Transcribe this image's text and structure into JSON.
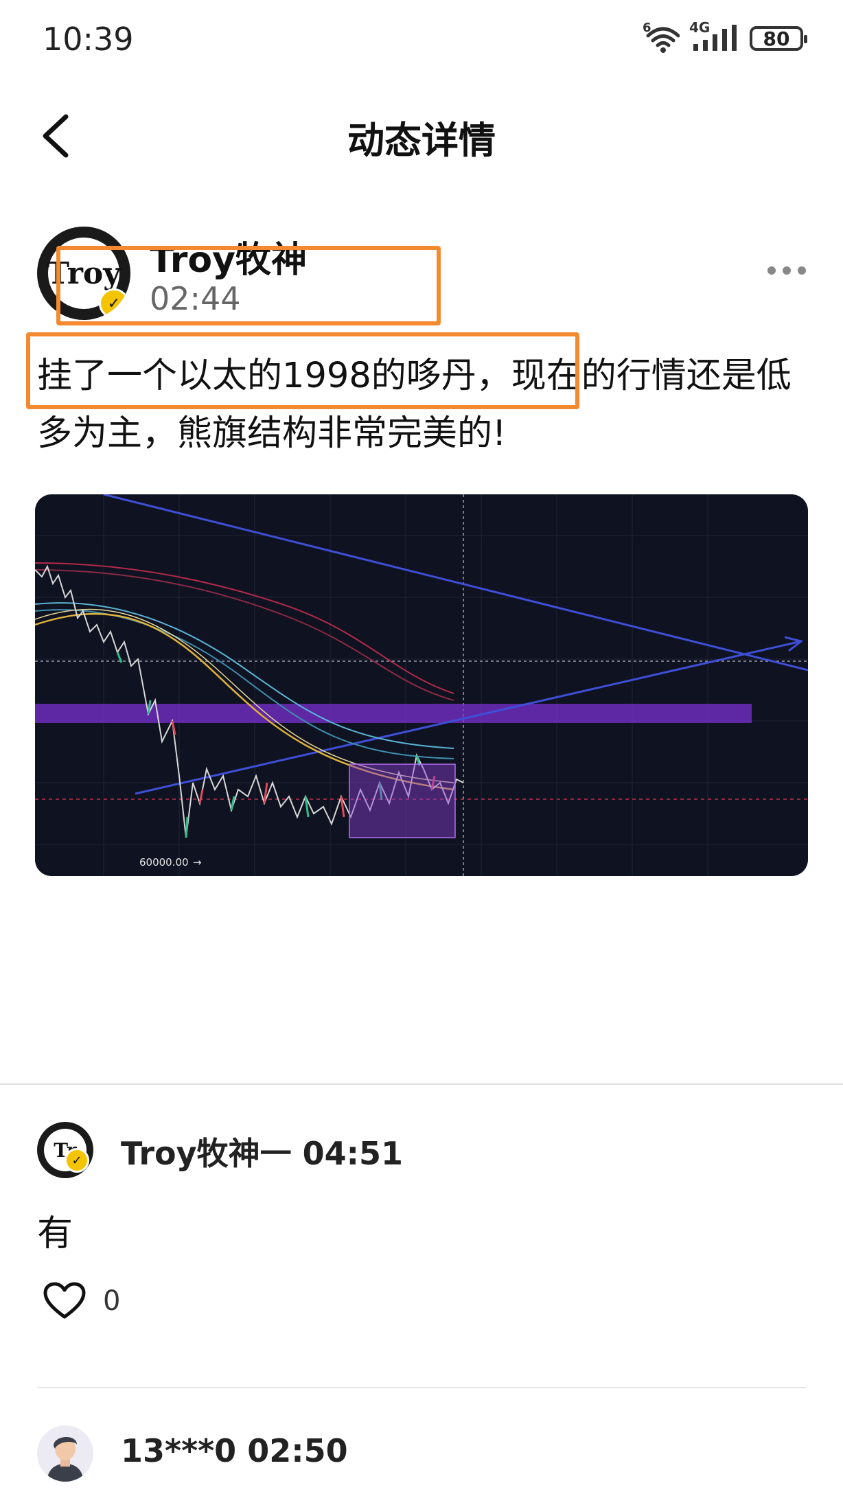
{
  "status_bar": {
    "time": "10:39",
    "wifi_label": "6",
    "network_label": "4G",
    "battery": "80"
  },
  "nav": {
    "title": "动态详情"
  },
  "post": {
    "author": "Troy牧神",
    "time": "02:44",
    "text": "挂了一个以太的1998的哆丹，现在的行情还是低多为主，熊旗结构非常完美的!",
    "chart_image": {
      "price_label": "60000.00"
    }
  },
  "comments": [
    {
      "meta": "Troy牧神一 04:51",
      "text": "有",
      "likes": "0"
    },
    {
      "meta": "13***0 02:50"
    }
  ],
  "colors": {
    "highlight": "#f48a30",
    "verify_badge": "#f5c400",
    "chart_bg": "#0f1220"
  }
}
